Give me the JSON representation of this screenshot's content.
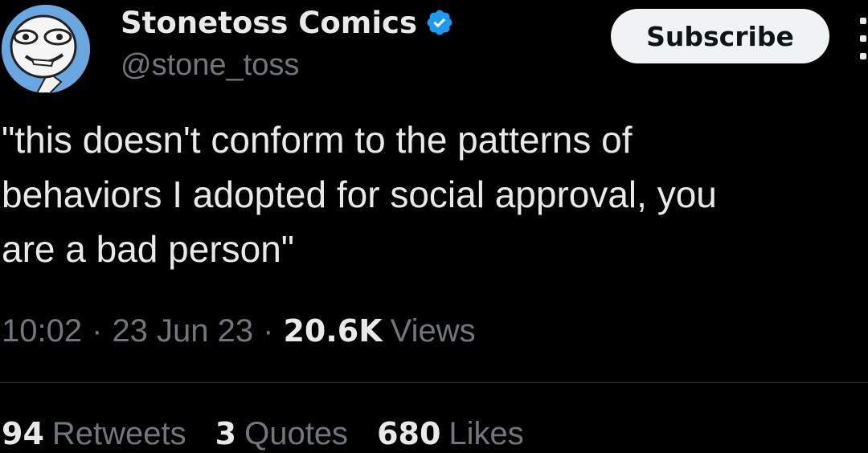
{
  "author": {
    "display_name": "Stonetoss Comics",
    "handle": "@stone_toss",
    "verified_icon": "verified-badge-icon",
    "avatar": "cartoon-face-avatar"
  },
  "actions": {
    "subscribe_label": "Subscribe",
    "more_icon": "more-vertical-icon"
  },
  "tweet": {
    "lines": [
      "\"this doesn't conform to the patterns of",
      "behaviors I adopted for social approval, you",
      "are a bad person\""
    ],
    "time": "10:02",
    "date": "23 Jun 23",
    "separator": "·",
    "views_count": "20.6K",
    "views_label": "Views"
  },
  "stats": [
    {
      "count": "94",
      "label": "Retweets"
    },
    {
      "count": "3",
      "label": "Quotes"
    },
    {
      "count": "680",
      "label": "Likes"
    }
  ],
  "colors": {
    "background": "#000000",
    "primary_text": "#e7e9ea",
    "secondary_text": "#71767b",
    "verified_blue": "#1d9bf0",
    "button_bg": "#eff3f4",
    "button_text": "#0f1419",
    "divider": "#2f3336"
  }
}
